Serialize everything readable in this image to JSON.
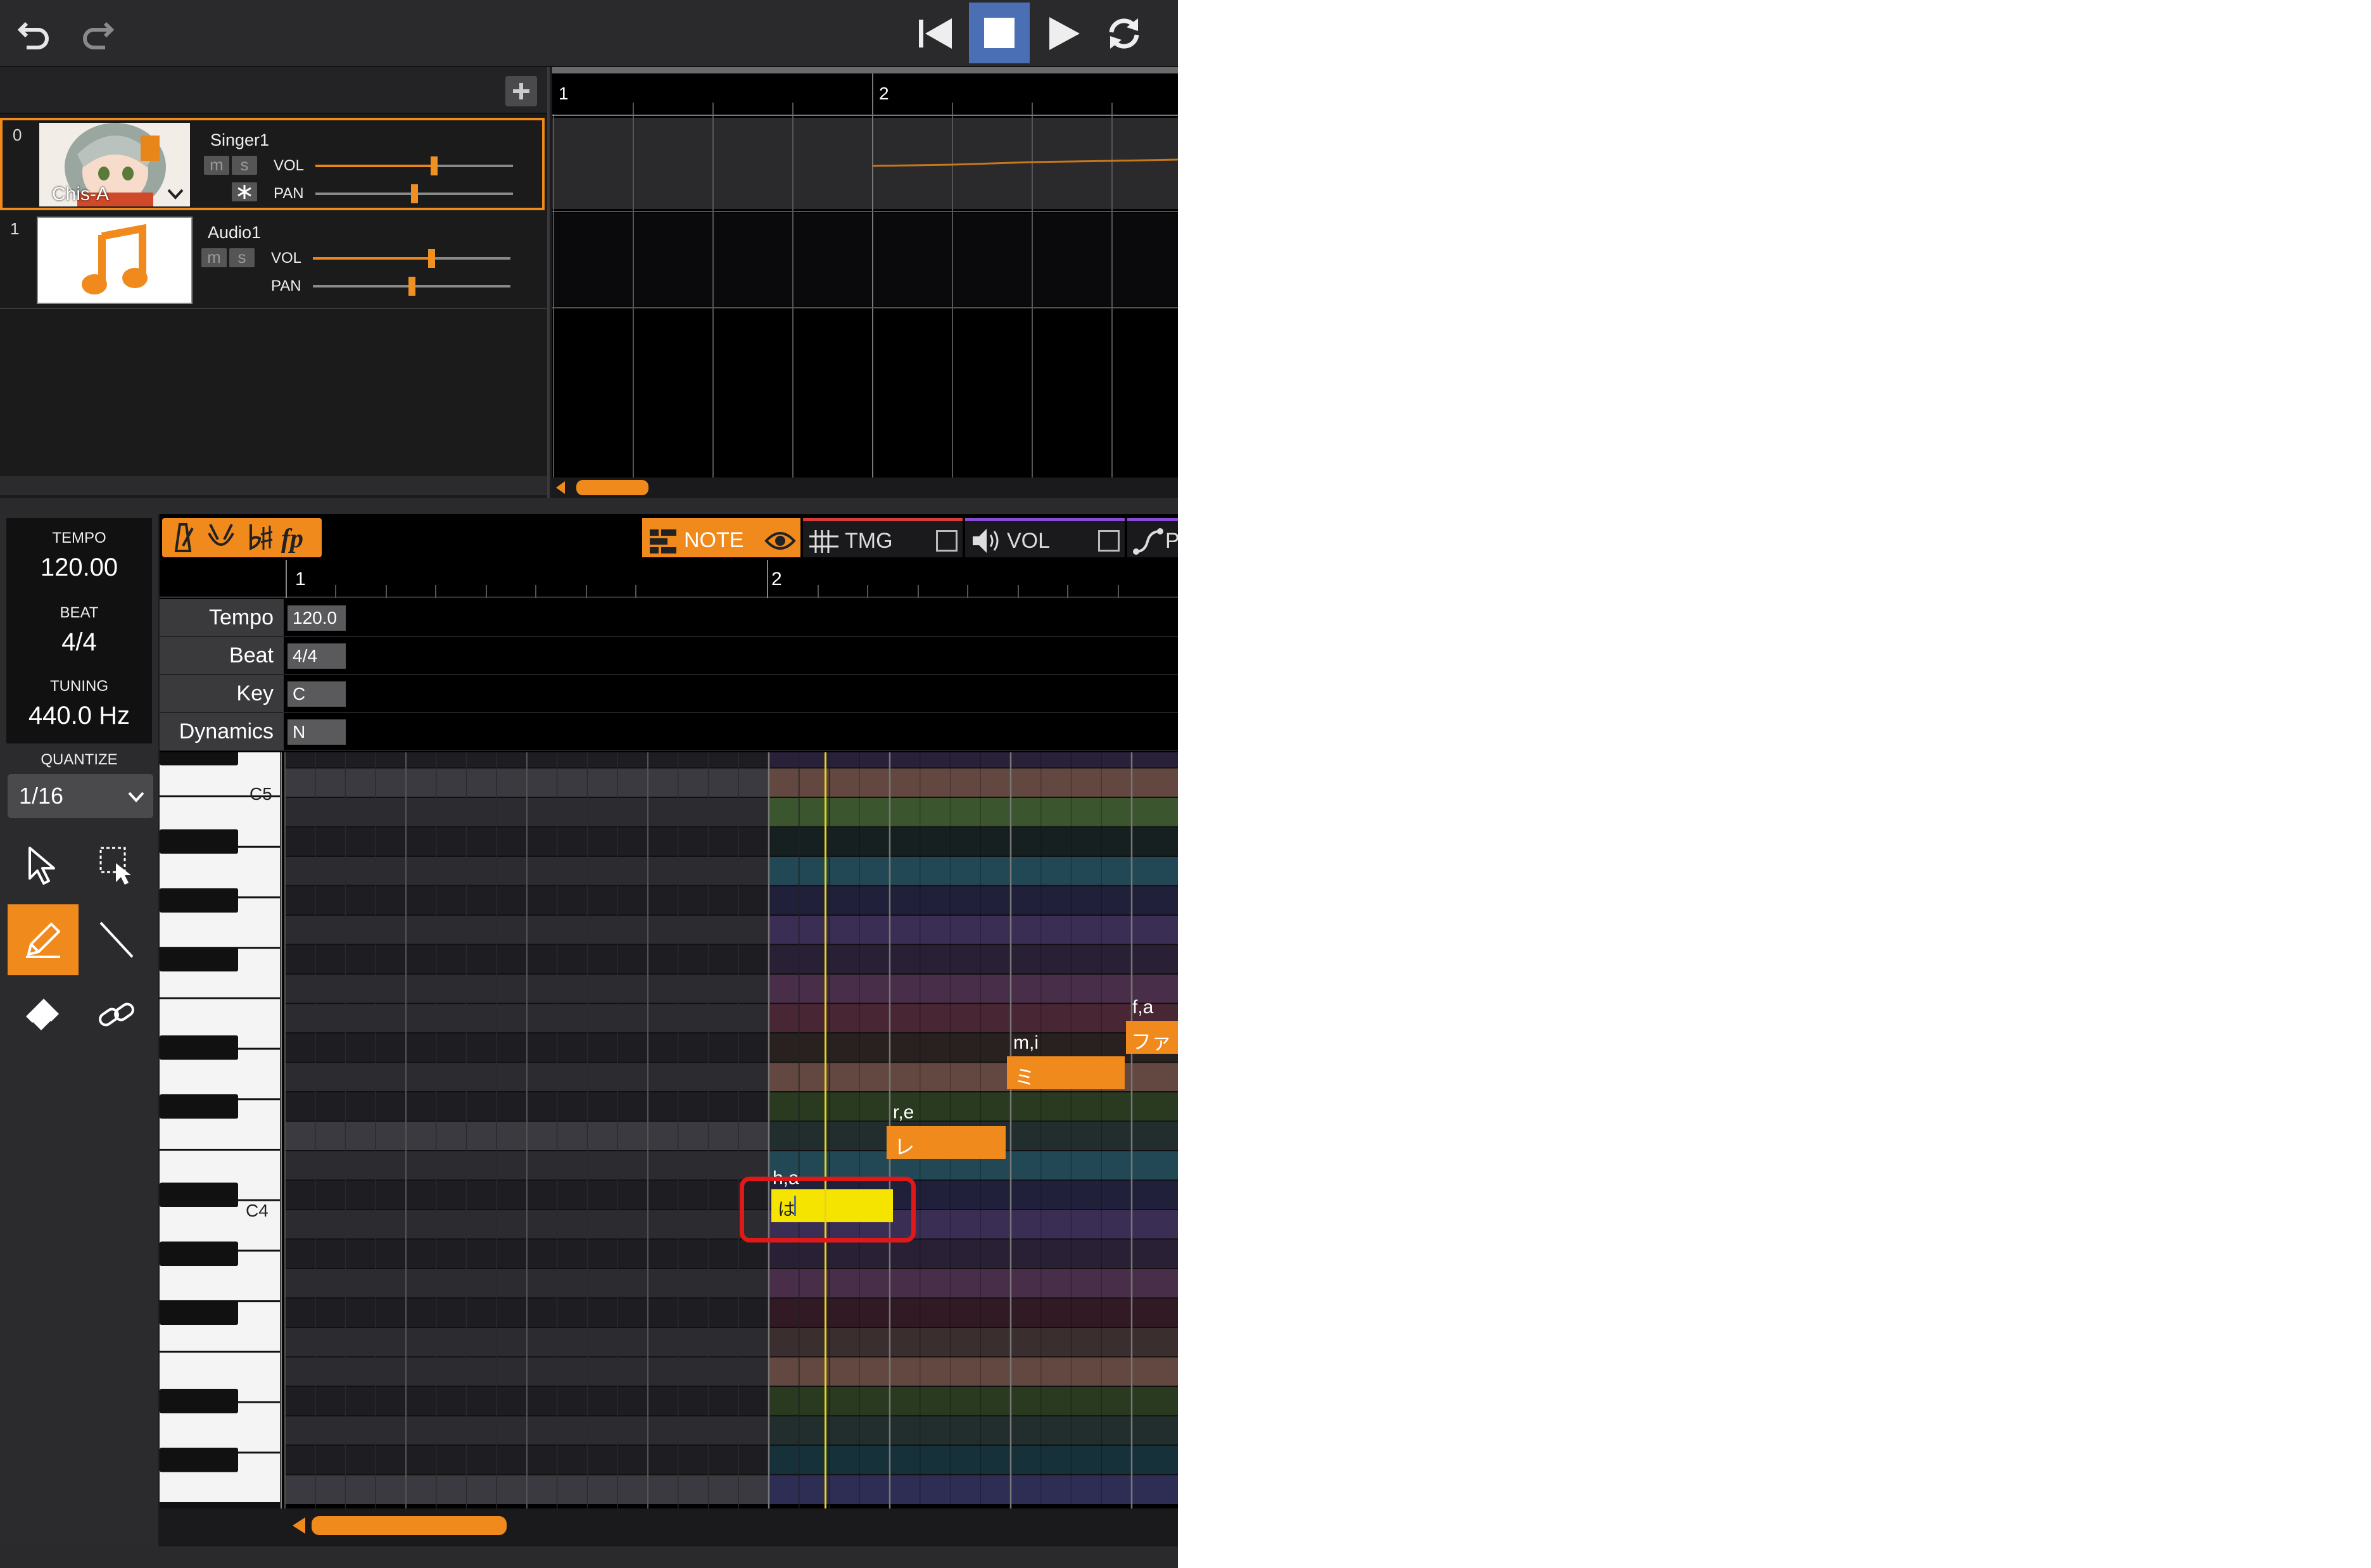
{
  "toolbar": {
    "undo_icon": "undo-icon",
    "redo_icon": "redo-icon",
    "rewind_icon": "skip-to-start-icon",
    "stop_icon": "stop-icon",
    "play_icon": "play-icon",
    "loop_icon": "loop-icon"
  },
  "tracks": {
    "add_icon": "plus-icon",
    "items": [
      {
        "index": "0",
        "name": "Singer1",
        "singer": "Chis-A",
        "m": "m",
        "s": "s",
        "solo_icon": "asterisk-icon",
        "vol_label": "VOL",
        "pan_label": "PAN",
        "vol_level": 0.6,
        "pan_level": 0.5
      },
      {
        "index": "1",
        "name": "Audio1",
        "m": "m",
        "s": "s",
        "vol_label": "VOL",
        "pan_label": "PAN",
        "vol_level": 0.6,
        "pan_level": 0.5,
        "thumb_icon": "music-note-icon"
      }
    ]
  },
  "arrangement": {
    "measures": [
      "1",
      "2"
    ]
  },
  "editor": {
    "mode_icons": [
      "metronome-icon",
      "conductor-icon",
      "key-signature-icon",
      "dynamics-icon"
    ],
    "tabs": [
      {
        "label": "NOTE",
        "icon": "piano-roll-icon",
        "active": true,
        "accent": "#f08a1c",
        "eye_icon": "eye-icon"
      },
      {
        "label": "TMG",
        "icon": "timing-icon",
        "active": false,
        "accent": "#d83a3a"
      },
      {
        "label": "VOL",
        "icon": "speaker-icon",
        "active": false,
        "accent": "#8a4ad8"
      },
      {
        "label": "P",
        "icon": "pitch-curve-icon",
        "active": false,
        "accent": "#8a4ad8"
      }
    ],
    "measures": [
      "1",
      "2"
    ],
    "params": [
      {
        "name": "Tempo",
        "value": "120.0"
      },
      {
        "name": "Beat",
        "value": "4/4"
      },
      {
        "name": "Key",
        "value": "C"
      },
      {
        "name": "Dynamics",
        "value": "N"
      }
    ],
    "key_labels": {
      "c5": "C5",
      "c4": "C4"
    },
    "notes": [
      {
        "phoneme": "h,a",
        "lyric": "は",
        "selected": true
      },
      {
        "phoneme": "r,e",
        "lyric": "レ",
        "selected": false
      },
      {
        "phoneme": "m,i",
        "lyric": "ミ",
        "selected": false
      },
      {
        "phoneme": "f,a",
        "lyric": "ファ",
        "selected": false
      }
    ]
  },
  "side": {
    "tempo_label": "TEMPO",
    "tempo_value": "120.00",
    "beat_label": "BEAT",
    "beat_value": "4/4",
    "tuning_label": "TUNING",
    "tuning_value": "440.0 Hz",
    "quantize_label": "QUANTIZE",
    "quantize_value": "1/16",
    "tools": [
      "arrow-select-icon",
      "range-select-icon",
      "pencil-icon",
      "line-icon",
      "eraser-icon",
      "link-icon"
    ]
  },
  "colors": {
    "accent": "#f08a1c",
    "selected_note": "#f5e400",
    "highlight": "#e01818"
  }
}
